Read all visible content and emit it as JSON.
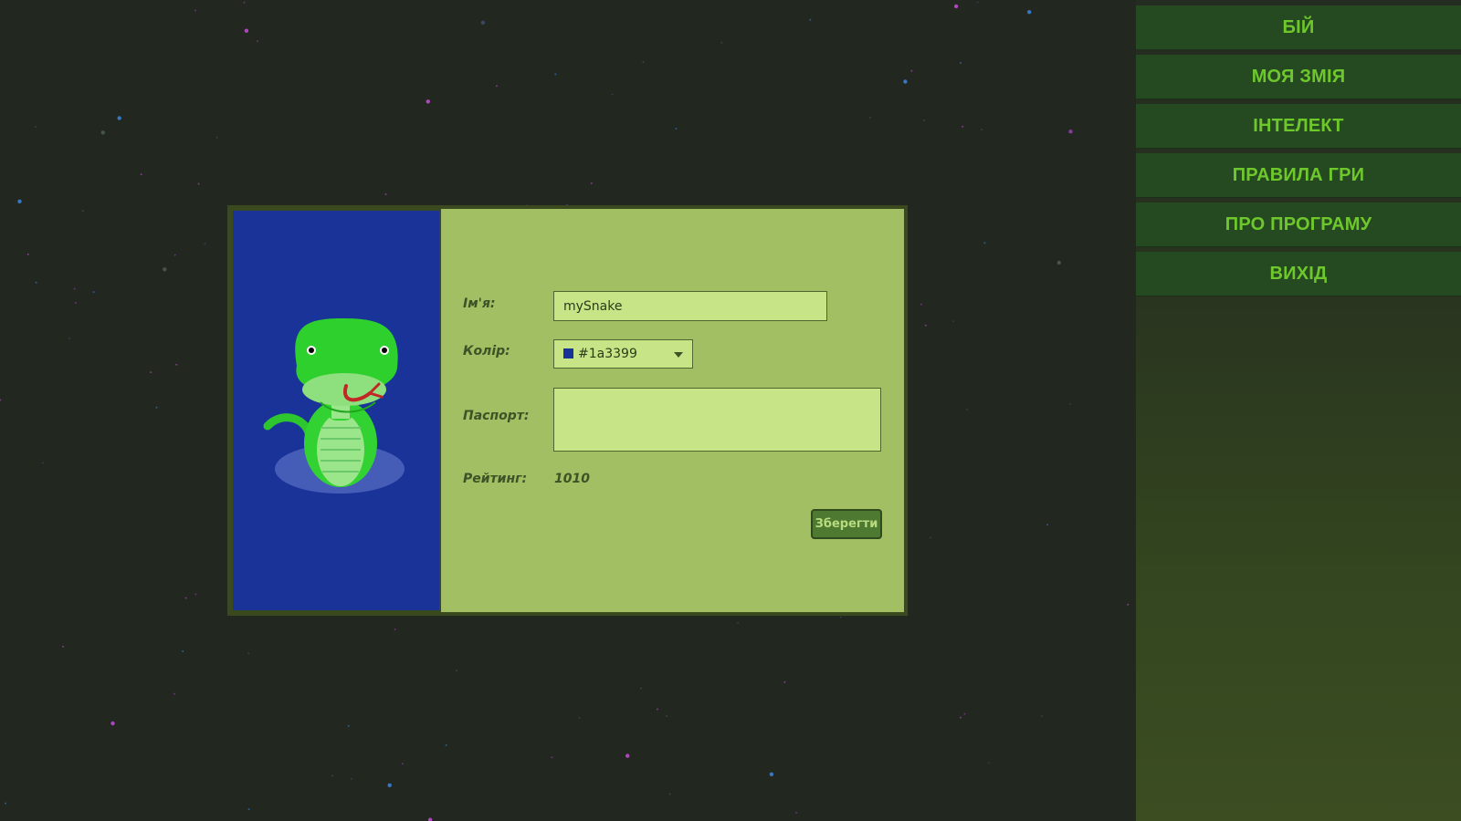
{
  "menu": {
    "items": [
      {
        "label": "БІЙ"
      },
      {
        "label": "МОЯ ЗМІЯ"
      },
      {
        "label": "ІНТЕЛЕКТ"
      },
      {
        "label": "ПРАВИЛА ГРИ"
      },
      {
        "label": "ПРО ПРОГРАМУ"
      },
      {
        "label": "ВИХІД"
      }
    ]
  },
  "profile": {
    "name_label": "Ім'я:",
    "name_value": "mySnake",
    "color_label": "Колір:",
    "color_value": "#1a3399",
    "passport_label": "Паспорт:",
    "passport_value": "",
    "rating_label": "Рейтинг:",
    "rating_value": "1010",
    "save_label": "Зберегти"
  },
  "colors": {
    "snake_color": "#1a3399",
    "menu_text": "#6ec82c",
    "menu_bg": "#254a22",
    "panel_bg": "#a2bf63",
    "field_bg": "#c7e586"
  },
  "icons": {
    "portrait": "snake-icon",
    "dropdown": "chevron-down-icon"
  }
}
